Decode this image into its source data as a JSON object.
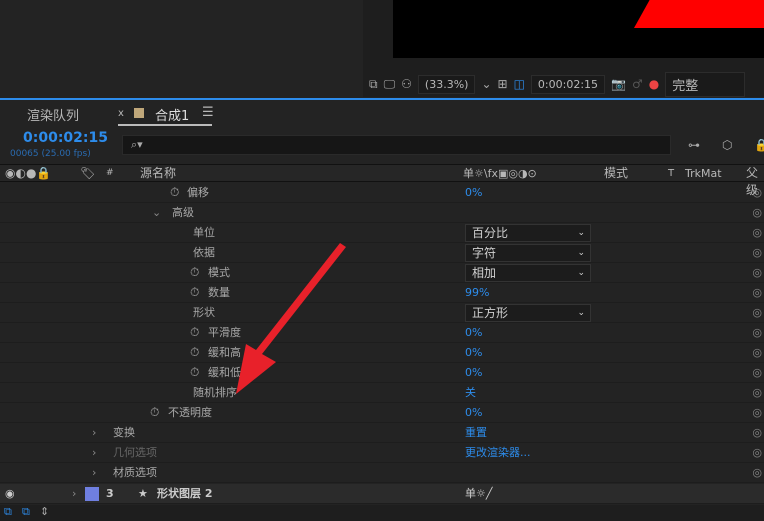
{
  "viewer": {
    "zoom": "(33.3%)",
    "timecode": "0:00:02:15",
    "quality": "完整"
  },
  "tabs": {
    "render_queue": "渲染队列",
    "comp": "合成1",
    "close": "x",
    "menu": "☰"
  },
  "timeline": {
    "timecode": "0:00:02:15",
    "frames": "00065 (25.00 fps)",
    "search_icon": "⌕▾"
  },
  "header": {
    "source_name": "源名称",
    "switches": "单☼\\fx▣◎◑⊙",
    "mode": "模式",
    "t": "T",
    "trkmat": "TrkMat",
    "parent": "父级",
    "hash": "#"
  },
  "rows": [
    {
      "label": "偏移",
      "value": "0%"
    },
    {
      "label": "高级"
    },
    {
      "label": "单位",
      "dropdown": "百分比"
    },
    {
      "label": "依据",
      "dropdown": "字符"
    },
    {
      "label": "模式",
      "dropdown": "相加"
    },
    {
      "label": "数量",
      "value": "99%"
    },
    {
      "label": "形状",
      "dropdown": "正方形"
    },
    {
      "label": "平滑度",
      "value": "0%"
    },
    {
      "label": "缓和高",
      "value": "0%"
    },
    {
      "label": "缓和低",
      "value": "0%"
    },
    {
      "label": "随机排序",
      "value": "关"
    },
    {
      "label": "不透明度",
      "value": "0%"
    },
    {
      "label": "变换",
      "value": "重置"
    },
    {
      "label": "几何选项",
      "value": "更改渲染器..."
    },
    {
      "label": "材质选项"
    }
  ],
  "layer": {
    "number": "3",
    "name": "形状图层 2",
    "color": "#6f7fe0"
  },
  "colors": {
    "accent": "#2d8ceb",
    "arrow": "#e8212a"
  }
}
